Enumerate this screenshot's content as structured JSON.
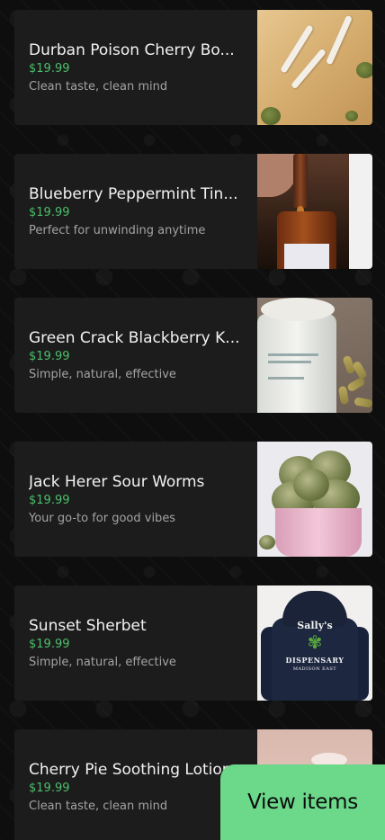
{
  "products": [
    {
      "name": "Durban Poison Cherry Bo...",
      "price": "$19.99",
      "tagline": "Clean taste, clean mind",
      "image": "pre-rolled-joints-photo"
    },
    {
      "name": "Blueberry Peppermint Tin...",
      "price": "$19.99",
      "tagline": "Perfect for unwinding anytime",
      "image": "tincture-dropper-photo"
    },
    {
      "name": "Green Crack Blackberry K...",
      "price": "$19.99",
      "tagline": "Simple, natural, effective",
      "image": "capsules-jar-photo"
    },
    {
      "name": "Jack Herer Sour Worms",
      "price": "$19.99",
      "tagline": "Your go-to for good vibes",
      "image": "cannabis-buds-cup-photo"
    },
    {
      "name": "Sunset Sherbet",
      "price": "$19.99",
      "tagline": "Simple, natural, effective",
      "image": "dispensary-hoodie-photo"
    },
    {
      "name": "Cherry Pie Soothing Lotion",
      "price": "$19.99",
      "tagline": "Clean taste, clean mind",
      "image": "lotion-hand-photo"
    }
  ],
  "hoodie_print": {
    "line1": "Sally's",
    "line2": "DISPENSARY",
    "line3": "MADISON EAST"
  },
  "cart": {
    "button_label": "View items"
  },
  "colors": {
    "price": "#4bbf6b",
    "button": "#6cd88a",
    "card": "#1c1c1c",
    "background": "#0e0e0e"
  }
}
